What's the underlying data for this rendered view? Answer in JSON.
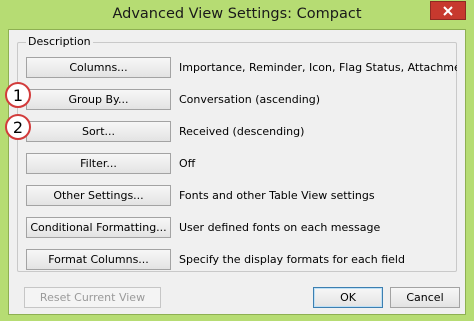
{
  "window": {
    "title": "Advanced View Settings: Compact"
  },
  "group": {
    "label": "Description"
  },
  "rows": [
    {
      "button": "Columns...",
      "description": "Importance, Reminder, Icon, Flag Status, Attachment, Fr..."
    },
    {
      "button": "Group By...",
      "description": "Conversation (ascending)"
    },
    {
      "button": "Sort...",
      "description": "Received (descending)"
    },
    {
      "button": "Filter...",
      "description": "Off"
    },
    {
      "button": "Other Settings...",
      "description": "Fonts and other Table View settings"
    },
    {
      "button": "Conditional Formatting...",
      "description": "User defined fonts on each message"
    },
    {
      "button": "Format Columns...",
      "description": "Specify the display formats for each field"
    }
  ],
  "callouts": [
    "1",
    "2"
  ],
  "footer": {
    "reset_label": "Reset Current View",
    "ok_label": "OK",
    "cancel_label": "Cancel"
  },
  "icons": {
    "close": "close-icon"
  },
  "colors": {
    "frame": "#b6dc73",
    "close_button": "#c7392e",
    "callout_ring": "#d23b3b"
  }
}
